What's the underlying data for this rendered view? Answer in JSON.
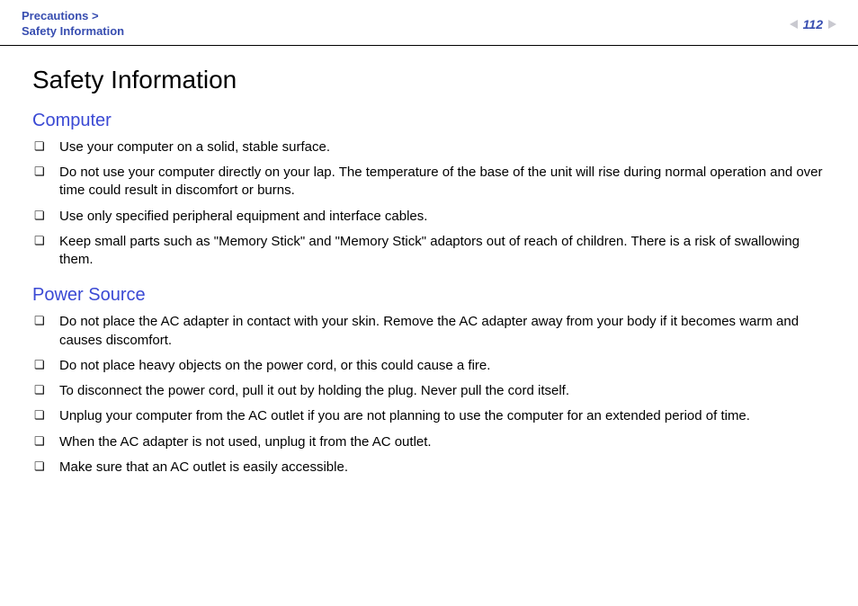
{
  "header": {
    "breadcrumb_line1": "Precautions >",
    "breadcrumb_line2": "Safety Information",
    "page_number": "112"
  },
  "title": "Safety Information",
  "sections": [
    {
      "heading": "Computer",
      "items": [
        "Use your computer on a solid, stable surface.",
        "Do not use your computer directly on your lap. The temperature of the base of the unit will rise during normal operation and over time could result in discomfort or burns.",
        "Use only specified peripheral equipment and interface cables.",
        "Keep small parts such as \"Memory Stick\" and \"Memory Stick\" adaptors out of reach of children. There is a risk of swallowing them."
      ]
    },
    {
      "heading": "Power Source",
      "items": [
        "Do not place the AC adapter in contact with your skin. Remove the AC adapter away from your body if it becomes warm and causes discomfort.",
        "Do not place heavy objects on the power cord, or this could cause a fire.",
        "To disconnect the power cord, pull it out by holding the plug. Never pull the cord itself.",
        "Unplug your computer from the AC outlet if you are not planning to use the computer for an extended period of time.",
        "When the AC adapter is not used, unplug it from the AC outlet.",
        "Make sure that an AC outlet is easily accessible."
      ]
    }
  ]
}
